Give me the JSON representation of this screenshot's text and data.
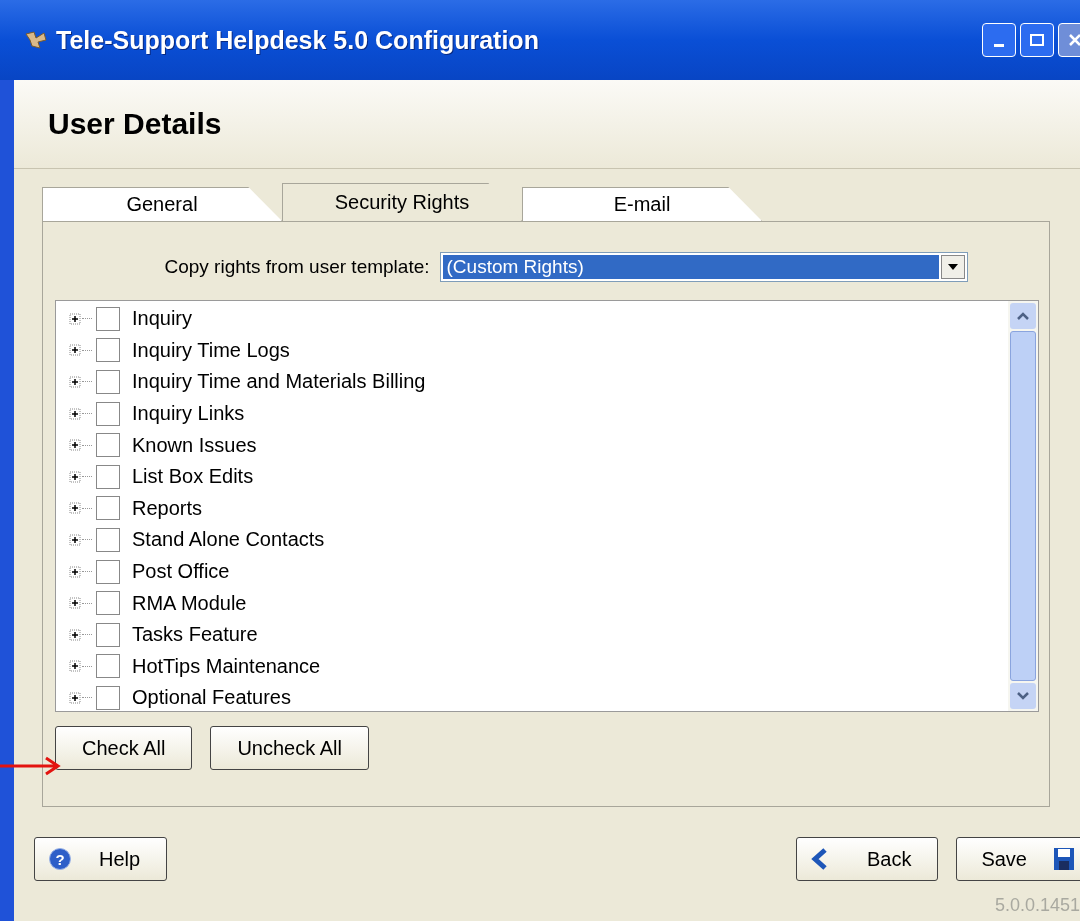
{
  "window": {
    "title": "Tele-Support Helpdesk 5.0 Configuration"
  },
  "header": {
    "title": "User Details"
  },
  "tabs": [
    {
      "label": "General",
      "selected": false
    },
    {
      "label": "Security Rights",
      "selected": true
    },
    {
      "label": "E-mail",
      "selected": false
    }
  ],
  "template": {
    "label": "Copy rights from user template:",
    "value": "(Custom Rights)"
  },
  "rights": [
    {
      "label": "Inquiry",
      "checked": false,
      "expanded": false
    },
    {
      "label": "Inquiry Time Logs",
      "checked": false,
      "expanded": false
    },
    {
      "label": "Inquiry Time and Materials Billing",
      "checked": false,
      "expanded": false
    },
    {
      "label": "Inquiry Links",
      "checked": false,
      "expanded": false
    },
    {
      "label": "Known Issues",
      "checked": false,
      "expanded": false
    },
    {
      "label": "List Box Edits",
      "checked": false,
      "expanded": false
    },
    {
      "label": "Reports",
      "checked": false,
      "expanded": false
    },
    {
      "label": "Stand Alone Contacts",
      "checked": false,
      "expanded": false
    },
    {
      "label": "Post Office",
      "checked": false,
      "expanded": false
    },
    {
      "label": "RMA Module",
      "checked": false,
      "expanded": false
    },
    {
      "label": "Tasks Feature",
      "checked": false,
      "expanded": false
    },
    {
      "label": "HotTips Maintenance",
      "checked": false,
      "expanded": false
    },
    {
      "label": "Optional Features",
      "checked": false,
      "expanded": false
    }
  ],
  "panel_buttons": [
    "Check All",
    "Uncheck All"
  ],
  "footer": {
    "help_icon": "?",
    "help": "Help",
    "back": "Back",
    "save": "Save",
    "version": "5.0.0.1451"
  }
}
